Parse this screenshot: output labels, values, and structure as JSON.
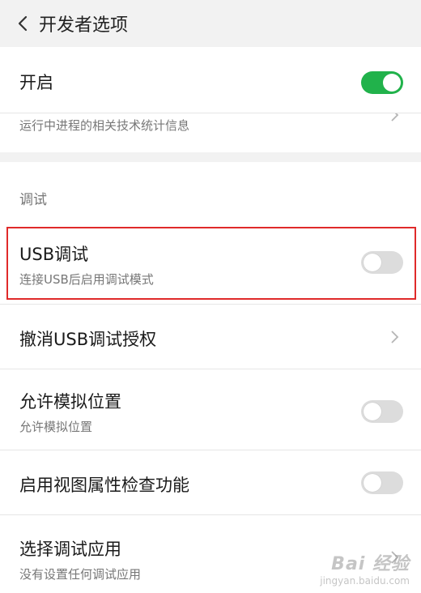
{
  "header": {
    "title": "开发者选项"
  },
  "top_card": {
    "enable_label": "开启",
    "enable_state": true,
    "partial_subtitle": "运行中进程的相关技术统计信息"
  },
  "debug_section": {
    "section_label": "调试",
    "items": [
      {
        "label": "USB调试",
        "subtitle": "连接USB后启用调试模式",
        "control": "toggle",
        "state": false
      },
      {
        "label": "撤消USB调试授权",
        "control": "chevron"
      },
      {
        "label": "允许模拟位置",
        "subtitle": "允许模拟位置",
        "control": "toggle",
        "state": false
      },
      {
        "label": "启用视图属性检查功能",
        "control": "toggle",
        "state": false
      },
      {
        "label": "选择调试应用",
        "subtitle": "没有设置任何调试应用",
        "control": "chevron"
      }
    ]
  },
  "watermark": {
    "brand": "Bai 经验",
    "url": "jingyan.baidu.com"
  },
  "colors": {
    "toggle_on": "#21b24b",
    "toggle_off": "#dcdcdc",
    "highlight": "#e02a2a"
  }
}
